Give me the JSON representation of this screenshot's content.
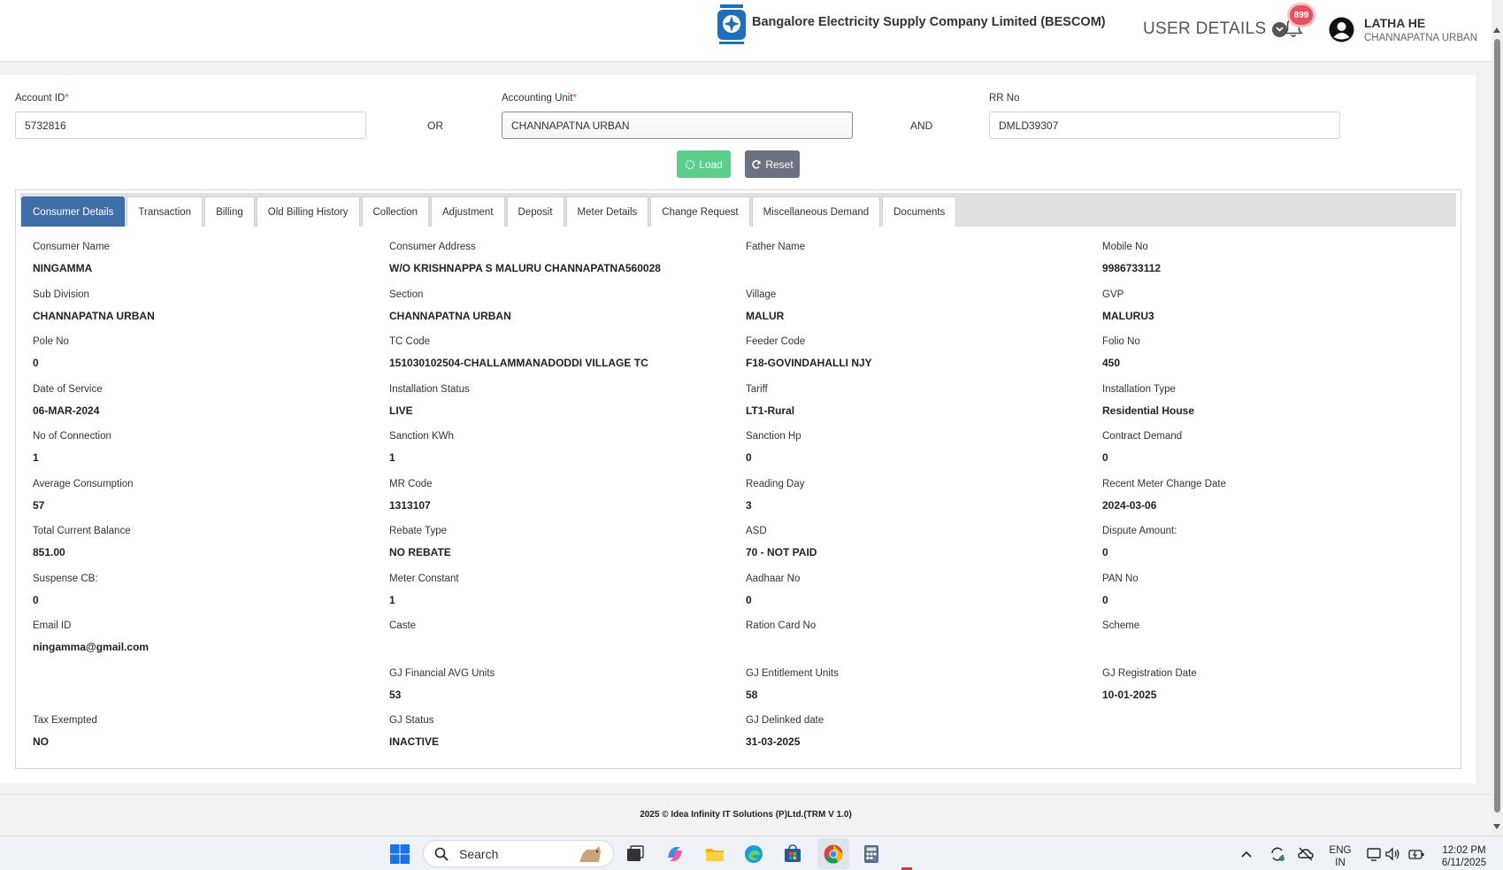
{
  "header": {
    "company": "Bangalore Electricity Supply Company Limited (BESCOM)",
    "user_details_label": "USER DETAILS",
    "notification_count": "899",
    "user_name": "LATHA HE",
    "user_unit": "CHANNAPATNA URBAN"
  },
  "search": {
    "account_id_label": "Account ID",
    "account_id_value": "5732816",
    "or_label": "OR",
    "accounting_unit_label": "Accounting Unit",
    "accounting_unit_value": "CHANNAPATNA URBAN",
    "and_label": "AND",
    "rr_no_label": "RR No",
    "rr_no_value": "DMLD39307",
    "load_label": "Load",
    "reset_label": "Reset"
  },
  "tabs": [
    {
      "label": "Consumer Details",
      "active": true
    },
    {
      "label": "Transaction"
    },
    {
      "label": "Billing"
    },
    {
      "label": "Old Billing History"
    },
    {
      "label": "Collection"
    },
    {
      "label": "Adjustment"
    },
    {
      "label": "Deposit"
    },
    {
      "label": "Meter Details"
    },
    {
      "label": "Change Request"
    },
    {
      "label": "Miscellaneous Demand"
    },
    {
      "label": "Documents"
    }
  ],
  "details": [
    {
      "label": "Consumer Name",
      "value": "NINGAMMA"
    },
    {
      "label": "Consumer Address",
      "value": "W/O KRISHNAPPA S MALURU CHANNAPATNA560028"
    },
    {
      "label": "Father Name",
      "value": ""
    },
    {
      "label": "Mobile No",
      "value": "9986733112"
    },
    {
      "label": "Sub Division",
      "value": "CHANNAPATNA URBAN"
    },
    {
      "label": "Section",
      "value": "CHANNAPATNA URBAN"
    },
    {
      "label": "Village",
      "value": "MALUR"
    },
    {
      "label": "GVP",
      "value": "MALURU3"
    },
    {
      "label": "Pole No",
      "value": "0"
    },
    {
      "label": "TC Code",
      "value": "151030102504-CHALLAMMANADODDI VILLAGE TC"
    },
    {
      "label": "Feeder Code",
      "value": "F18-GOVINDAHALLI NJY"
    },
    {
      "label": "Folio No",
      "value": "450"
    },
    {
      "label": "Date of Service",
      "value": "06-MAR-2024"
    },
    {
      "label": "Installation Status",
      "value": "LIVE"
    },
    {
      "label": "Tariff",
      "value": "LT1-Rural"
    },
    {
      "label": "Installation Type",
      "value": "Residential House"
    },
    {
      "label": "No of Connection",
      "value": "1"
    },
    {
      "label": "Sanction KWh",
      "value": "1"
    },
    {
      "label": "Sanction Hp",
      "value": "0"
    },
    {
      "label": "Contract Demand",
      "value": "0"
    },
    {
      "label": "Average Consumption",
      "value": "57"
    },
    {
      "label": "MR Code",
      "value": "1313107"
    },
    {
      "label": "Reading Day",
      "value": "3"
    },
    {
      "label": "Recent Meter Change Date",
      "value": "2024-03-06"
    },
    {
      "label": "Total Current Balance",
      "value": "851.00"
    },
    {
      "label": "Rebate Type",
      "value": "NO REBATE"
    },
    {
      "label": "ASD",
      "value": "70 - NOT PAID"
    },
    {
      "label": "Dispute Amount:",
      "value": "0"
    },
    {
      "label": "Suspense CB:",
      "value": "0"
    },
    {
      "label": "Meter Constant",
      "value": "1"
    },
    {
      "label": "Aadhaar No",
      "value": "0"
    },
    {
      "label": "PAN No",
      "value": "0"
    },
    {
      "label": "Email ID",
      "value": "ningamma@gmail.com"
    },
    {
      "label": "Caste",
      "value": ""
    },
    {
      "label": "Ration Card No",
      "value": ""
    },
    {
      "label": "Scheme",
      "value": ""
    },
    {
      "label": "",
      "value": ""
    },
    {
      "label": "GJ Financial AVG Units",
      "value": "53"
    },
    {
      "label": "GJ Entitlement Units",
      "value": "58"
    },
    {
      "label": "GJ Registration Date",
      "value": "10-01-2025"
    },
    {
      "label": "Tax Exempted",
      "value": "NO"
    },
    {
      "label": "GJ Status",
      "value": "INACTIVE"
    },
    {
      "label": "GJ Delinked date",
      "value": "31-03-2025"
    },
    {
      "label": "",
      "value": ""
    }
  ],
  "footer": {
    "text": "2025 © Idea Infinity IT Solutions (P)Ltd.(TRM V 1.0)"
  },
  "taskbar": {
    "search_label": "Search",
    "lang_top": "ENG",
    "lang_bottom": "IN",
    "time": "12:02 PM",
    "date": "6/11/2025"
  },
  "colors": {
    "accent": "#3f6da8",
    "load": "#5cce8c",
    "reset": "#6c7282",
    "required": "#d9534f"
  }
}
